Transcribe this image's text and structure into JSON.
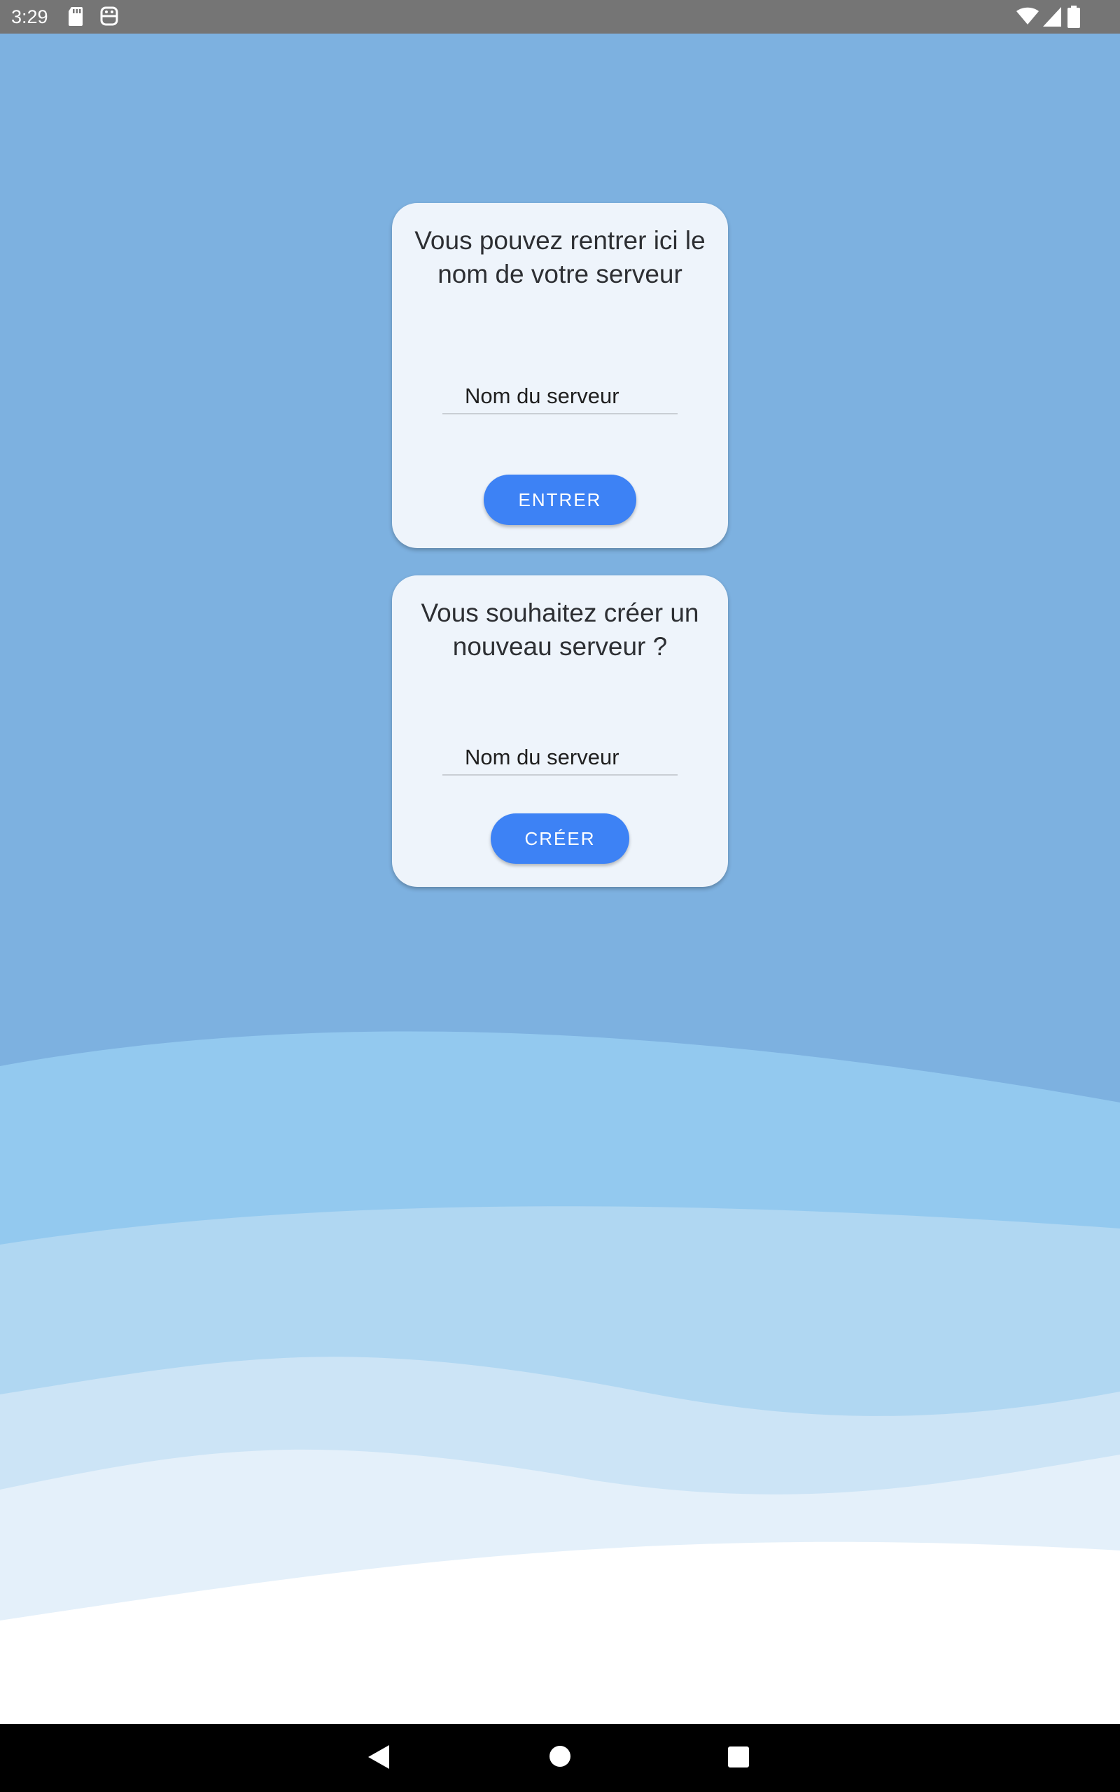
{
  "status_bar": {
    "time": "3:29",
    "left_icons": [
      "sd-card-icon",
      "recording-icon"
    ],
    "right_icons": [
      "wifi-icon",
      "cell-signal-icon",
      "battery-icon"
    ]
  },
  "background": {
    "base_color": "#7db1e0",
    "wave_colors": [
      "#93c9ef",
      "#b0d7f2",
      "#cce4f6",
      "#e4f0fa",
      "#ffffff"
    ]
  },
  "join_card": {
    "title": "Vous pouvez rentrer ici le nom de votre serveur",
    "input_placeholder": "Nom du serveur",
    "input_value": "",
    "button_label": "ENTRER"
  },
  "create_card": {
    "title": "Vous souhaitez créer un nouveau serveur ?",
    "input_placeholder": "Nom du serveur",
    "input_value": "",
    "button_label": "CRÉER"
  },
  "navigation_bar": {
    "buttons": [
      "back-icon",
      "home-icon",
      "recents-icon"
    ]
  },
  "colors": {
    "accent": "#3d82f5",
    "card": "#eef4fb",
    "status_bar": "#757575"
  }
}
